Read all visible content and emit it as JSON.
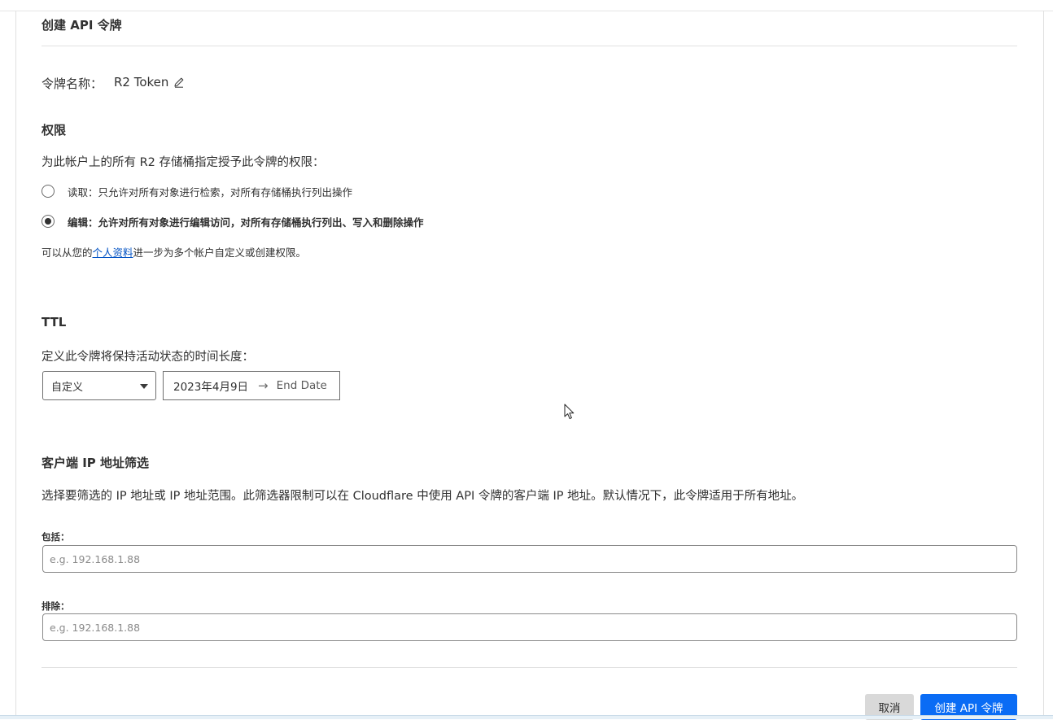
{
  "page_title": "创建 API 令牌",
  "token_name": {
    "label": "令牌名称：",
    "value": "R2 Token",
    "edit_icon": "pencil-icon"
  },
  "permissions": {
    "title": "权限",
    "description": "为此帐户上的所有 R2 存储桶指定授予此令牌的权限：",
    "options": [
      {
        "label": "读取：只允许对所有对象进行检索，对所有存储桶执行列出操作",
        "checked": false
      },
      {
        "label": "编辑：允许对所有对象进行编辑访问，对所有存储桶执行列出、写入和删除操作",
        "checked": true
      }
    ],
    "note_prefix": "可以从您的",
    "note_link": "个人资料",
    "note_suffix": "进一步为多个帐户自定义或创建权限。"
  },
  "ttl": {
    "title": "TTL",
    "description": "定义此令牌将保持活动状态的时间长度：",
    "select_value": "自定义",
    "start_date": "2023年4月9日",
    "arrow": "→",
    "end_date_placeholder": "End Date"
  },
  "ip_filter": {
    "title": "客户端 IP 地址筛选",
    "description": "选择要筛选的 IP 地址或 IP 地址范围。此筛选器限制可以在 Cloudflare 中使用 API 令牌的客户端 IP 地址。默认情况下，此令牌适用于所有地址。",
    "include_label": "包括：",
    "include_placeholder": "e.g. 192.168.1.88",
    "exclude_label": "排除：",
    "exclude_placeholder": "e.g. 192.168.1.88"
  },
  "buttons": {
    "cancel": "取消",
    "create": "创建 API 令牌"
  },
  "colors": {
    "primary": "#0a6cf5",
    "link": "#0051c3",
    "cancel_bg": "#d9d9d9"
  }
}
